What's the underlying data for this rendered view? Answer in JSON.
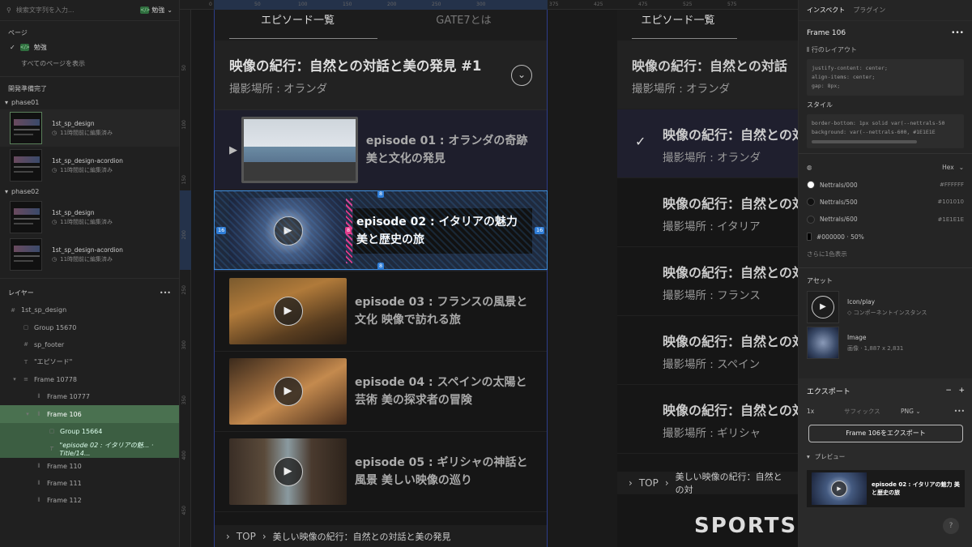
{
  "left": {
    "search_placeholder": "検索文字列を入力...",
    "page_pill": "勉強",
    "pages_header": "ページ",
    "pages": [
      {
        "label": "勉強"
      },
      {
        "label": "すべてのページを表示"
      }
    ],
    "section_label": "開発準備完了",
    "groups": [
      {
        "name": "phase01",
        "items": [
          {
            "name": "1st_sp_design",
            "time": "11時間前に編集済み"
          },
          {
            "name": "1st_sp_design-acordion",
            "time": "11時間前に編集済み"
          }
        ]
      },
      {
        "name": "phase02",
        "items": [
          {
            "name": "1st_sp_design",
            "time": "11時間前に編集済み"
          },
          {
            "name": "1st_sp_design-acordion",
            "time": "11時間前に編集済み"
          }
        ]
      }
    ],
    "layers_header": "レイヤー",
    "layers": [
      {
        "label": "1st_sp_design",
        "icon": "#"
      },
      {
        "label": "Group 15670",
        "icon": "▢"
      },
      {
        "label": "sp_footer",
        "icon": "#"
      },
      {
        "label": "\"エピソード\"",
        "icon": "T"
      },
      {
        "label": "Frame 10778",
        "icon": "≡"
      },
      {
        "label": "Frame 10777",
        "icon": "⫴"
      },
      {
        "label": "Frame 106",
        "icon": "⫴"
      },
      {
        "label": "Group 15664",
        "icon": "▢"
      },
      {
        "label": "\"episode 02 : イタリアの魅... · Title/14...",
        "icon": "T"
      },
      {
        "label": "Frame 110",
        "icon": "⫴"
      },
      {
        "label": "Frame 111",
        "icon": "⫴"
      },
      {
        "label": "Frame 112",
        "icon": "⫴"
      }
    ]
  },
  "canvas": {
    "ruler_top": [
      "0",
      "50",
      "100",
      "150",
      "200",
      "250",
      "300",
      "375",
      "425",
      "475",
      "525",
      "575"
    ],
    "ruler_left": [
      "50",
      "100",
      "150",
      "200",
      "250",
      "300",
      "350",
      "400",
      "450"
    ],
    "tabs": [
      "エピソード一覧",
      "GATE7とは"
    ],
    "hero": {
      "title": "映像の紀行：自然との対話と美の発見 #1",
      "subtitle": "撮影場所 : オランダ"
    },
    "episodes": [
      {
        "caption": "episode 01 : オランダの奇跡 美と文化の発見"
      },
      {
        "caption": "episode 02 : イタリアの魅力 美と歴史の旅"
      },
      {
        "caption": "episode 03 : フランスの風景と文化 映像で訪れる旅"
      },
      {
        "caption": "episode 04 : スペインの太陽と芸術 美の探求者の冒険"
      },
      {
        "caption": "episode 05 : ギリシャの神話と風景 美しい映像の巡り"
      }
    ],
    "spacing": {
      "top": "8",
      "left": "16",
      "right": "16",
      "gap": "8",
      "bottom": "8"
    },
    "breadcrumb": {
      "top": "TOP",
      "current": "美しい映像の紀行：自然との対話と美の発見"
    },
    "frame2": {
      "tab": "エピソード一覧",
      "items": [
        {
          "title": "映像の紀行：自然との対話",
          "place": "撮影場所 : オランダ"
        },
        {
          "title": "映像の紀行：自然との対",
          "place": "撮影場所 : オランダ"
        },
        {
          "title": "映像の紀行：自然との対",
          "place": "撮影場所 : イタリア"
        },
        {
          "title": "映像の紀行：自然との対",
          "place": "撮影場所 : フランス"
        },
        {
          "title": "映像の紀行：自然との対",
          "place": "撮影場所 : スペイン"
        },
        {
          "title": "映像の紀行：自然との対",
          "place": "撮影場所 : ギリシャ"
        }
      ],
      "crumb": "美しい映像の紀行：自然との対",
      "logo": "SPORTS"
    }
  },
  "right": {
    "tabs": [
      "インスペクト",
      "プラグイン"
    ],
    "title": "Frame 106",
    "layout_label": "行のレイアウト",
    "layout_code": [
      "justify-content: center;",
      "align-items: center;",
      "gap: 8px;"
    ],
    "style_label": "スタイル",
    "style_code": [
      "border-bottom: 1px solid var(--nettrals-50",
      "background: var(--nettrals-600, #1E1E1E"
    ],
    "color_mode": "Hex",
    "colors": [
      {
        "name": "Nettrals/000",
        "hex": "#FFFFFF",
        "color": "#ffffff"
      },
      {
        "name": "Nettrals/500",
        "hex": "#101010",
        "color": "#101010"
      },
      {
        "name": "Nettrals/600",
        "hex": "#1E1E1E",
        "color": "#1e1e1e"
      },
      {
        "name": "#000000 · 50%",
        "hex": "",
        "color": "#000000"
      }
    ],
    "more_colors": "さらに1色表示",
    "assets_label": "アセット",
    "assets": [
      {
        "title": "Icon/play",
        "sub": "コンポーネントインスタンス"
      },
      {
        "title": "Image",
        "sub": "画像 · 1,887 x 2,831"
      }
    ],
    "export_label": "エクスポート",
    "export_scale": "1x",
    "export_suffix": "サフィックス",
    "export_format": "PNG",
    "export_button": "Frame 106をエクスポート",
    "preview_label": "プレビュー",
    "preview_caption": "episode 02 : イタリアの魅力 美と歴史の旅"
  }
}
